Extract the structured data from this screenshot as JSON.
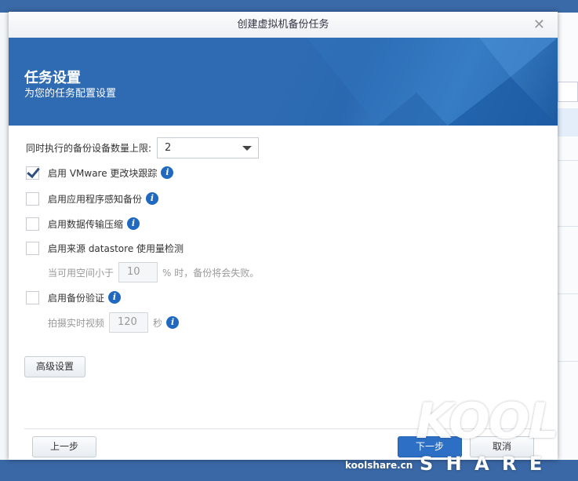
{
  "dialog": {
    "title": "创建虚拟机备份任务",
    "close": "✕"
  },
  "banner": {
    "title": "任务设置",
    "subtitle": "为您的任务配置设置"
  },
  "form": {
    "concurrent_label": "同时执行的备份设备数量上限:",
    "concurrent_value": "2",
    "options": [
      {
        "label": "启用 VMware 更改块跟踪",
        "checked": true
      },
      {
        "label": "启用应用程序感知备份",
        "checked": false
      },
      {
        "label": "启用数据传输压缩",
        "checked": false
      },
      {
        "label": "启用来源 datastore 使用量检测",
        "checked": false
      },
      {
        "label": "启用备份验证",
        "checked": false
      }
    ],
    "space_prefix": "当可用空间小于",
    "space_value": "10",
    "space_suffix": "% 时，备份将会失败。",
    "video_prefix": "拍摄实时视频",
    "video_value": "120",
    "video_suffix": "秒",
    "info": "i",
    "advanced": "高级设置"
  },
  "footer": {
    "back": "上一步",
    "next": "下一步",
    "cancel": "取消"
  },
  "watermark": {
    "logo": "KOOL",
    "share": "S H A R E",
    "site": "koolshare.cn"
  }
}
